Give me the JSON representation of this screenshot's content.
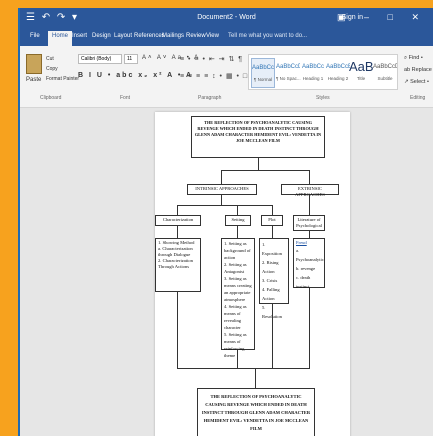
{
  "window": {
    "quick_access": "☰ ↶ ↷ ▾",
    "title": "Document2 - Word",
    "signin": "Sign in",
    "controls": "▣ – □ ✕"
  },
  "tabs": [
    "File",
    "Home",
    "Insert",
    "Design",
    "Layout",
    "References",
    "Mailings",
    "Review",
    "View"
  ],
  "tell_me": "Tell me what you want to do...",
  "clipboard": {
    "paste": "Paste",
    "cut": "Cut",
    "copy": "Copy",
    "format_painter": "Format Painter",
    "label": "Clipboard"
  },
  "font": {
    "name": "Calibri (Body)",
    "size": "11",
    "row1": "A˄ A˅ Aa • A",
    "row2": "B I U • abc x₂ x² A • A",
    "label": "Font"
  },
  "paragraph": {
    "row1": "≡ • ≡ • ⇤ ⇥ ⇅ ¶",
    "row2": "≡ ≡ ≡ ≡ ↕ • ▦ • □",
    "label": "Paragraph"
  },
  "styles": {
    "items": [
      {
        "sample": "AaBbCcDc",
        "name": "¶ Normal"
      },
      {
        "sample": "AaBbCcDc",
        "name": "¶ No Spac..."
      },
      {
        "sample": "AaBbCc",
        "name": "Heading 1"
      },
      {
        "sample": "AaBbCcE",
        "name": "Heading 2"
      },
      {
        "sample": "AaB",
        "name": "Title"
      },
      {
        "sample": "AaBbCcD",
        "name": "Subtitle"
      }
    ],
    "label": "Styles"
  },
  "editing": {
    "find": "⌕ Find •",
    "replace": "ab Replace",
    "select": "↗ Select •",
    "label": "Editing"
  },
  "diagram": {
    "top_title": "THE REFLECTION OF PSYCHOANALYTIC CAUSING REVENGE WHICH ENDED IN DEATH INSTINCT THROUGH GLENN ADAM CHARACTER HEMIDENT EVIL: VENDETTA IN JOE MCCLEAN FILM",
    "intrinsic": "INTRINSIC APPROACHES",
    "extrinsic": "EXTRINSIC APPROACHES",
    "characterization": "Characterization",
    "setting": "Setting",
    "plot": "Plot",
    "literature": "Literature of Psychological",
    "char_list": "1. Showing Method\na. Characterization through Dialogue\n2. Characterization Through Actions",
    "setting_list": "1. Setting as background of action\n2. Setting as Antagonist\n3. Setting as means creating an appropriate atmosphere\n4. Setting as means of revealing character\n5. Setting as means of reinforcing theme",
    "plot_list": "1. Exposition\n2. Rising Action\n3. Crisis\n4. Falling Action\n5. Resolution",
    "lit_head": "Freud",
    "lit_list": "a. Psychoanalytic\nb. revenge\nc. death instinct",
    "bottom_title": "THE REFLECTION OF PSYCHOANALYTIC CAUSING REVENGE WHICH ENDED IN DEATH INSTINCT THROUGH GLENN ADAM CHARACTER HEMIDENT EVIL: VENDETTA IN JOE MCCLEAN FILM"
  }
}
